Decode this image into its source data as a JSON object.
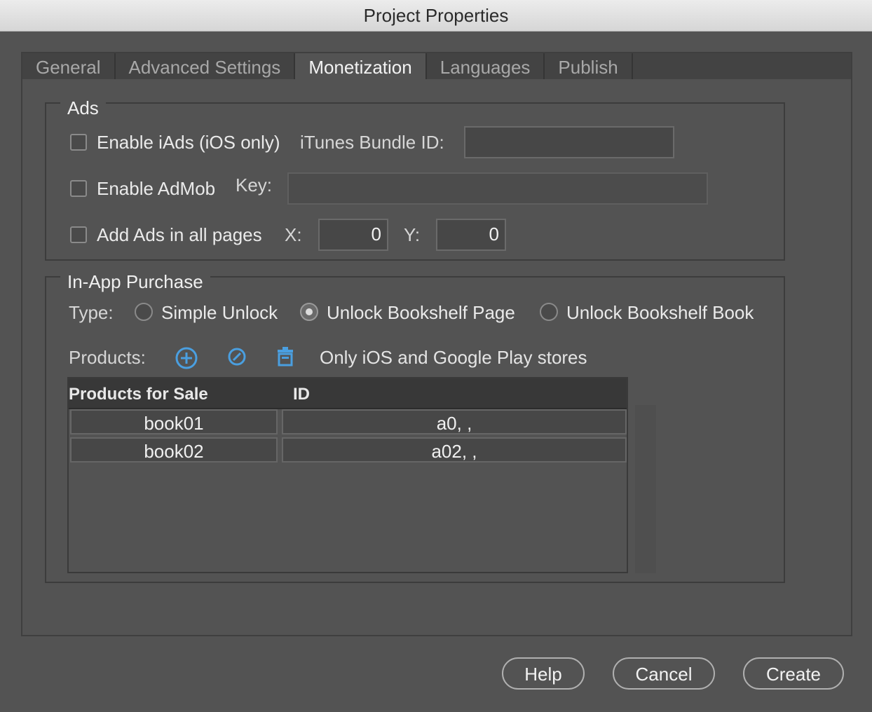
{
  "window": {
    "title": "Project Properties"
  },
  "tabs": [
    {
      "label": "General",
      "active": false
    },
    {
      "label": "Advanced Settings",
      "active": false
    },
    {
      "label": "Monetization",
      "active": true
    },
    {
      "label": "Languages",
      "active": false
    },
    {
      "label": "Publish",
      "active": false
    }
  ],
  "ads": {
    "legend": "Ads",
    "iads": {
      "label": "Enable iAds (iOS only)",
      "checked": false
    },
    "itunes_bundle_label": "iTunes Bundle ID:",
    "itunes_bundle_value": "",
    "admob": {
      "label": "Enable AdMob",
      "checked": false
    },
    "key_label": "Key:",
    "key_value": "",
    "all_pages": {
      "label": "Add Ads in all pages",
      "checked": false
    },
    "x_label": "X:",
    "x_value": "0",
    "y_label": "Y:",
    "y_value": "0"
  },
  "iap": {
    "legend": "In-App Purchase",
    "type_label": "Type:",
    "types": [
      {
        "label": "Simple Unlock",
        "selected": false
      },
      {
        "label": "Unlock Bookshelf Page",
        "selected": true
      },
      {
        "label": "Unlock Bookshelf Book",
        "selected": false
      }
    ],
    "products_label": "Products:",
    "products_note": "Only iOS and Google Play stores",
    "icons": [
      "add-icon",
      "edit-icon",
      "delete-icon"
    ],
    "table": {
      "columns": [
        "Products for Sale",
        "ID"
      ],
      "rows": [
        [
          "book01",
          "a0, ,"
        ],
        [
          "book02",
          "a02, ,"
        ]
      ]
    }
  },
  "buttons": {
    "help": "Help",
    "cancel": "Cancel",
    "create": "Create"
  },
  "colors": {
    "accent": "#4a9fe0",
    "background": "#535353"
  }
}
